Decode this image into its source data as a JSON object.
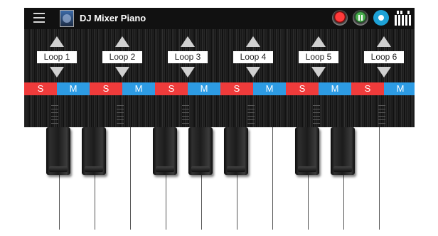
{
  "app": {
    "title": "DJ Mixer Piano"
  },
  "toolbar": {
    "menu_icon": "menu-icon",
    "record_icon": "record-icon",
    "pause_icon": "pause-icon",
    "play_icon": "play-icon",
    "piano_icon": "piano-keys-icon"
  },
  "loops": [
    {
      "label": "Loop 1",
      "solo": "S",
      "mute": "M"
    },
    {
      "label": "Loop 2",
      "solo": "S",
      "mute": "M"
    },
    {
      "label": "Loop 3",
      "solo": "S",
      "mute": "M"
    },
    {
      "label": "Loop 4",
      "solo": "S",
      "mute": "M"
    },
    {
      "label": "Loop 5",
      "solo": "S",
      "mute": "M"
    },
    {
      "label": "Loop 6",
      "solo": "S",
      "mute": "M"
    }
  ],
  "colors": {
    "solo": "#ef3b3b",
    "mute": "#2d9be3",
    "record": "#ff3b3b",
    "pause": "#4caf50",
    "play": "#1da1d6"
  },
  "keyboard": {
    "white_keys": 11,
    "black_keys": 7
  }
}
